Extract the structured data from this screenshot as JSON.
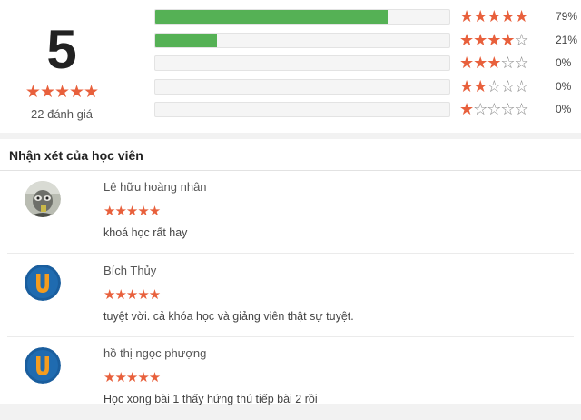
{
  "summary": {
    "score": "5",
    "score_stars": "★★★★★",
    "review_count": "22 đánh giá",
    "bars": [
      {
        "filled": "★★★★★",
        "empty": "",
        "percent_label": "79%",
        "fraction": 0.79
      },
      {
        "filled": "★★★★",
        "empty": "☆",
        "percent_label": "21%",
        "fraction": 0.21
      },
      {
        "filled": "★★★",
        "empty": "☆☆",
        "percent_label": "0%",
        "fraction": 0
      },
      {
        "filled": "★★",
        "empty": "☆☆☆",
        "percent_label": "0%",
        "fraction": 0
      },
      {
        "filled": "★",
        "empty": "☆☆☆☆",
        "percent_label": "0%",
        "fraction": 0
      }
    ],
    "colors": {
      "bar_fill": "#55b155",
      "star": "#e8603c"
    }
  },
  "reviews_section": {
    "title": "Nhận xét của học viên",
    "reviews": [
      {
        "name": "Lê hữu hoàng nhân",
        "stars": "★★★★★",
        "text": "khoá học rất hay",
        "avatar": "photo-avatar"
      },
      {
        "name": "Bích Thủy",
        "stars": "★★★★★",
        "text": "tuyệt vời. cả khóa học và giảng viên thật sự tuyệt.",
        "avatar": "u-logo-avatar"
      },
      {
        "name": "hồ thị ngọc phượng",
        "stars": "★★★★★",
        "text": "Học xong bài 1 thấy hứng thú tiếp bài 2 rồi",
        "avatar": "u-logo-avatar"
      }
    ]
  }
}
